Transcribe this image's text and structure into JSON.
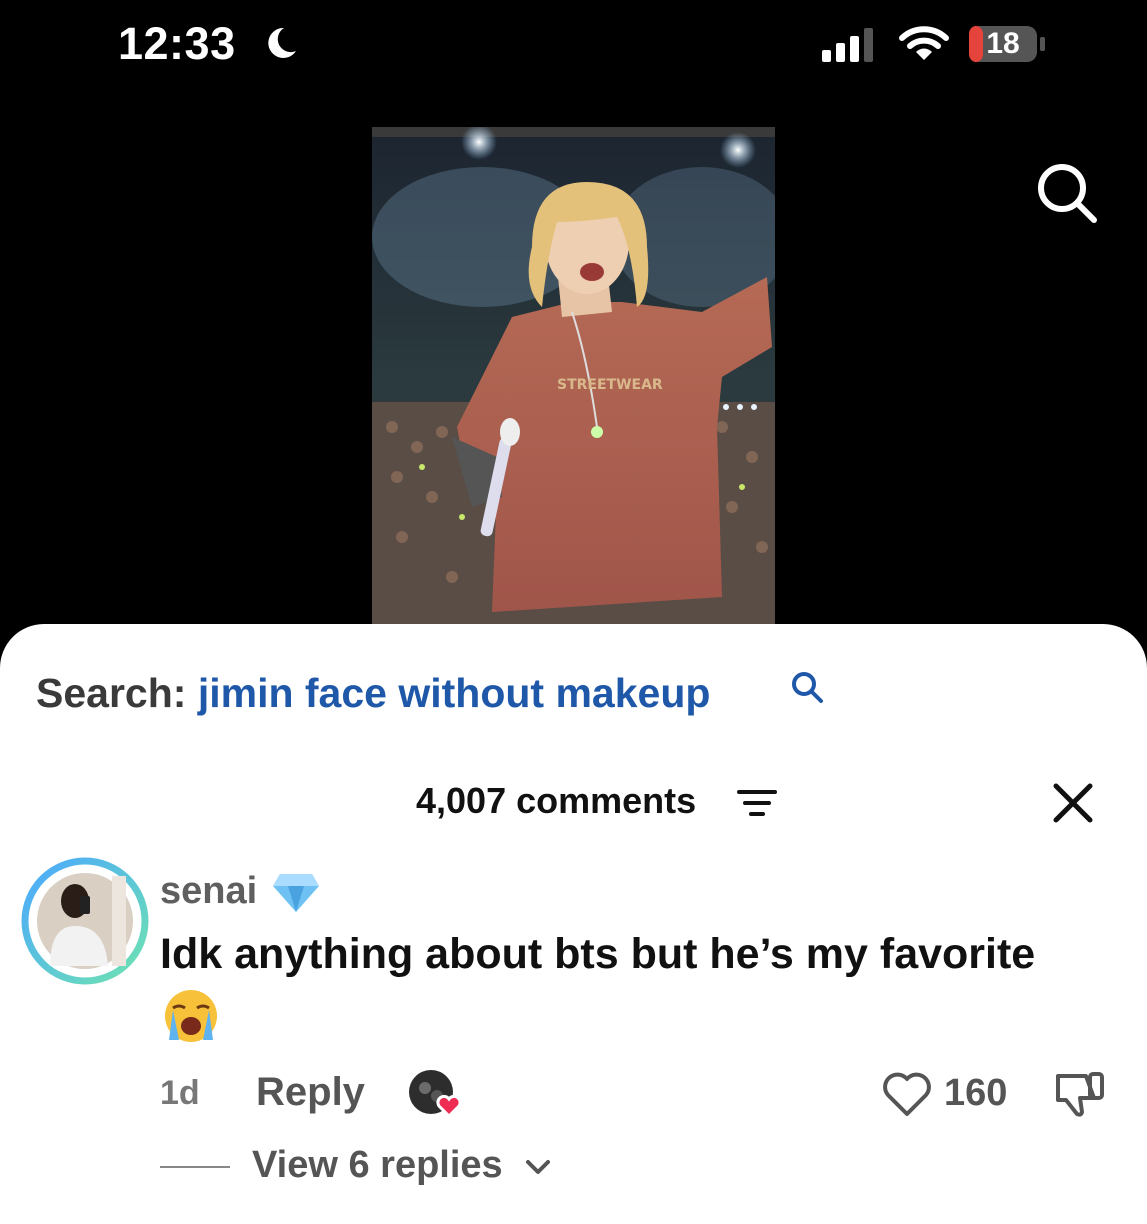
{
  "status_bar": {
    "time": "12:33",
    "battery": "18",
    "icons": [
      "moon-icon",
      "cellular-signal-icon",
      "wifi-icon",
      "battery-icon"
    ]
  },
  "video": {
    "shirt_text": "STREETWEAR"
  },
  "search": {
    "label": "Search:",
    "query": "jimin face without makeup",
    "query_color": "#1f58a8"
  },
  "comments": {
    "count_label": "4,007 comments",
    "items": [
      {
        "username": "senai",
        "badge": "diamond-emoji",
        "text": "Idk anything about bts but he’s my favorite",
        "emoji": "😭",
        "age": "1d",
        "reply_label": "Reply",
        "likes": "160",
        "view_replies": "View 6 replies"
      }
    ]
  },
  "colors": {
    "background": "#000000",
    "sheet": "#ffffff",
    "link_blue": "#1f58a8",
    "battery_red": "#e5443c"
  }
}
